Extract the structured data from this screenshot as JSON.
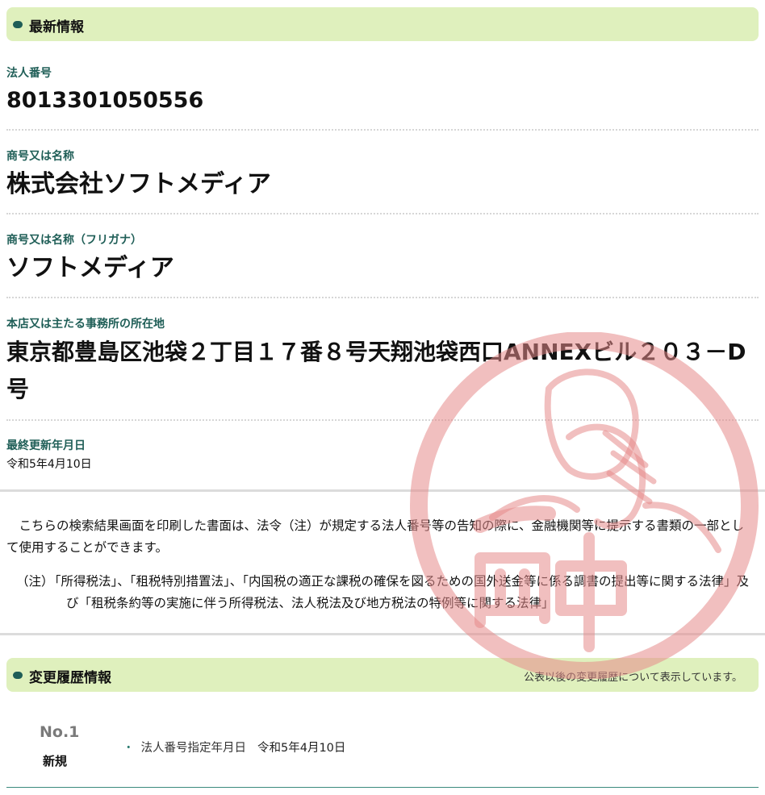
{
  "latest": {
    "section_title": "最新情報",
    "fields": [
      {
        "label": "法人番号",
        "value": "8013301050556"
      },
      {
        "label": "商号又は名称",
        "value": "株式会社ソフトメディア"
      },
      {
        "label": "商号又は名称（フリガナ）",
        "value": "ソフトメディア"
      },
      {
        "label": "本店又は主たる事務所の所在地",
        "value": "東京都豊島区池袋２丁目１７番８号天翔池袋西口ANNEXビル２０３－D号"
      },
      {
        "label": "最終更新年月日",
        "value": "令和5年4月10日"
      }
    ]
  },
  "notice": {
    "main": "　こちらの検索結果画面を印刷した書面は、法令（注）が規定する法人番号等の告知の際に、金融機関等に提示する書類の一部として使用することができます。",
    "note_prefix": "（注）",
    "note_text": "「所得税法」、「租税特別措置法」、「内国税の適正な課税の確保を図るための国外送金等に係る調書の提出等に関する法律」及び「租税条約等の実施に伴う所得税法、法人税法及び地方税法の特例等に関する法律」"
  },
  "history": {
    "section_title": "変更履歴情報",
    "note": "公表以後の変更履歴について表示しています。",
    "entries": [
      {
        "no": "No.1",
        "kind": "新規",
        "item_label": "法人番号指定年月日",
        "item_value": "令和5年4月10日"
      }
    ]
  },
  "colors": {
    "accent": "#1f5e57",
    "bar": "#dff0bd",
    "stamp": "#e58a8a"
  }
}
